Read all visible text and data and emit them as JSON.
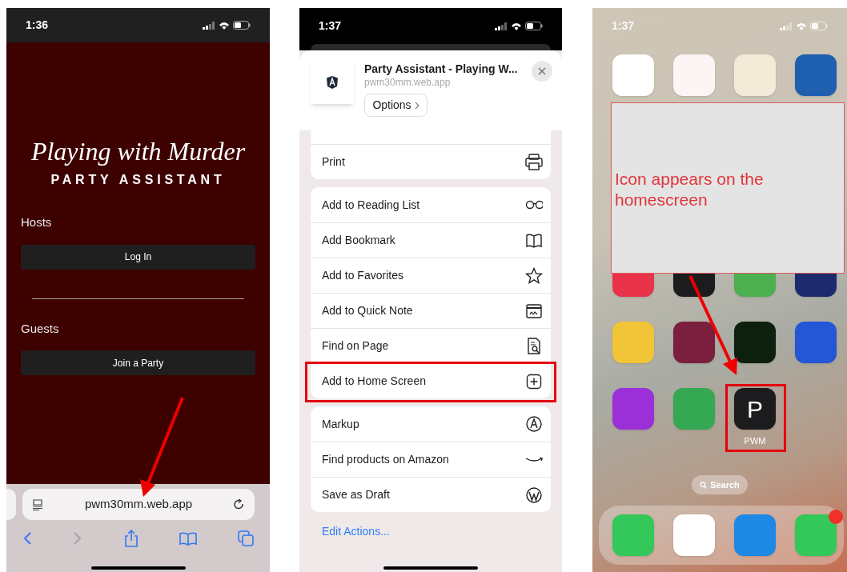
{
  "login_screen": {
    "status_time": "1:36",
    "logo_title": "Playing with Murder",
    "logo_subtitle": "PARTY ASSISTANT",
    "sections": [
      {
        "heading": "Hosts",
        "button": "Log In"
      },
      {
        "heading": "Guests",
        "button": "Join a Party"
      }
    ],
    "url": "pwm30mm.web.app"
  },
  "share_sheet": {
    "status_time": "1:37",
    "title": "Party Assistant - Playing W...",
    "url": "pwm30mm.web.app",
    "options_button": "Options",
    "groups": [
      [
        {
          "label": "Print",
          "highlighted": false
        }
      ],
      [
        {
          "label": "Add to Reading List",
          "highlighted": false
        },
        {
          "label": "Add Bookmark",
          "highlighted": false
        },
        {
          "label": "Add to Favorites",
          "highlighted": false
        },
        {
          "label": "Add to Quick Note",
          "highlighted": false
        },
        {
          "label": "Find on Page",
          "highlighted": false
        },
        {
          "label": "Add to Home Screen",
          "highlighted": true
        }
      ],
      [
        {
          "label": "Markup",
          "highlighted": false
        },
        {
          "label": "Find products on Amazon",
          "highlighted": false
        },
        {
          "label": "Save as Draft",
          "highlighted": false
        }
      ]
    ],
    "edit_actions": "Edit Actions..."
  },
  "home_screen": {
    "status_time": "1:37",
    "callout": "Icon appears on the homescreen",
    "rows": [
      [
        {
          "color": "#ffffff"
        },
        {
          "color": "#fdf5f5"
        },
        {
          "color": "#f3ead8"
        },
        {
          "color": "#1f5fb0"
        }
      ],
      [
        {
          "color": "#e8334a"
        },
        {
          "color": "#1c1c1e"
        },
        {
          "color": "#4caf50"
        },
        {
          "color": "#1e2a6e"
        }
      ],
      [
        {
          "color": "#f2c437"
        },
        {
          "color": "#7a1f3d"
        },
        {
          "color": "#0d1f0d"
        },
        {
          "color": "#2456d6"
        }
      ],
      [
        {
          "color": "#9b30d9"
        },
        {
          "color": "#34a853"
        },
        {
          "color": "#1c1c1e",
          "glyph": "P",
          "label": "PWM",
          "highlighted": true
        }
      ]
    ],
    "search": "Search",
    "dock": [
      {
        "color": "#34c759"
      },
      {
        "color": "#ffffff"
      },
      {
        "color": "#1e88e5"
      },
      {
        "color": "#34c759",
        "badge": true
      }
    ]
  }
}
